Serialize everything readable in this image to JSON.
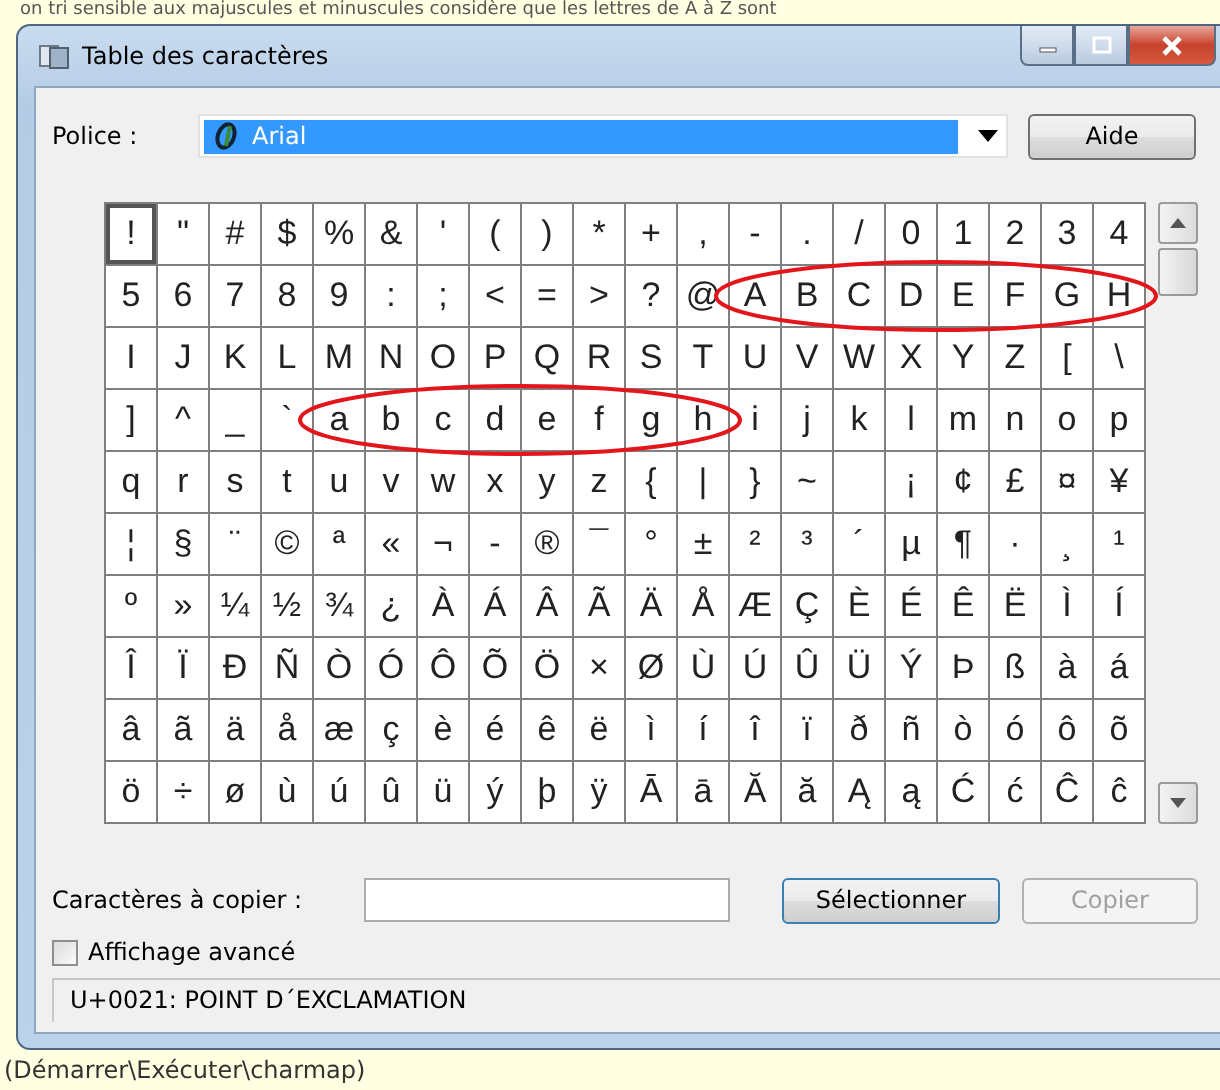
{
  "page_note": "on tri sensible aux majuscules et minuscules considère que les lettres de A à Z sont",
  "window": {
    "title": "Table des caractères"
  },
  "font_label": "Police :",
  "font_value": "Arial",
  "help_button": "Aide",
  "grid": [
    [
      {
        "char": "!",
        "selected": true,
        "circled": false
      },
      {
        "char": "\"",
        "selected": false,
        "circled": false
      },
      {
        "char": "#",
        "selected": false,
        "circled": false
      },
      {
        "char": "$",
        "selected": false,
        "circled": false
      },
      {
        "char": "%",
        "selected": false,
        "circled": false
      },
      {
        "char": "&",
        "selected": false,
        "circled": false
      },
      {
        "char": "'",
        "selected": false,
        "circled": false
      },
      {
        "char": "(",
        "selected": false,
        "circled": false
      },
      {
        "char": ")",
        "selected": false,
        "circled": false
      },
      {
        "char": "*",
        "selected": false,
        "circled": false
      },
      {
        "char": "+",
        "selected": false,
        "circled": false
      },
      {
        "char": ",",
        "selected": false,
        "circled": false
      },
      {
        "char": "-",
        "selected": false,
        "circled": false
      },
      {
        "char": ".",
        "selected": false,
        "circled": false
      },
      {
        "char": "/",
        "selected": false,
        "circled": false
      },
      {
        "char": "0",
        "selected": false,
        "circled": false
      },
      {
        "char": "1",
        "selected": false,
        "circled": false
      },
      {
        "char": "2",
        "selected": false,
        "circled": false
      },
      {
        "char": "3",
        "selected": false,
        "circled": false
      },
      {
        "char": "4",
        "selected": false,
        "circled": false
      }
    ],
    [
      {
        "char": "5",
        "selected": false,
        "circled": false
      },
      {
        "char": "6",
        "selected": false,
        "circled": false
      },
      {
        "char": "7",
        "selected": false,
        "circled": false
      },
      {
        "char": "8",
        "selected": false,
        "circled": false
      },
      {
        "char": "9",
        "selected": false,
        "circled": false
      },
      {
        "char": ":",
        "selected": false,
        "circled": false
      },
      {
        "char": ";",
        "selected": false,
        "circled": false
      },
      {
        "char": "<",
        "selected": false,
        "circled": false
      },
      {
        "char": "=",
        "selected": false,
        "circled": false
      },
      {
        "char": ">",
        "selected": false,
        "circled": false
      },
      {
        "char": "?",
        "selected": false,
        "circled": false
      },
      {
        "char": "@",
        "selected": false,
        "circled": false
      },
      {
        "char": "A",
        "selected": false,
        "circled": true
      },
      {
        "char": "B",
        "selected": false,
        "circled": true
      },
      {
        "char": "C",
        "selected": false,
        "circled": true
      },
      {
        "char": "D",
        "selected": false,
        "circled": true
      },
      {
        "char": "E",
        "selected": false,
        "circled": true
      },
      {
        "char": "F",
        "selected": false,
        "circled": true
      },
      {
        "char": "G",
        "selected": false,
        "circled": true
      },
      {
        "char": "H",
        "selected": false,
        "circled": true
      }
    ],
    [
      {
        "char": "I",
        "selected": false,
        "circled": false
      },
      {
        "char": "J",
        "selected": false,
        "circled": false
      },
      {
        "char": "K",
        "selected": false,
        "circled": false
      },
      {
        "char": "L",
        "selected": false,
        "circled": false
      },
      {
        "char": "M",
        "selected": false,
        "circled": false
      },
      {
        "char": "N",
        "selected": false,
        "circled": false
      },
      {
        "char": "O",
        "selected": false,
        "circled": false
      },
      {
        "char": "P",
        "selected": false,
        "circled": false
      },
      {
        "char": "Q",
        "selected": false,
        "circled": false
      },
      {
        "char": "R",
        "selected": false,
        "circled": false
      },
      {
        "char": "S",
        "selected": false,
        "circled": false
      },
      {
        "char": "T",
        "selected": false,
        "circled": false
      },
      {
        "char": "U",
        "selected": false,
        "circled": false
      },
      {
        "char": "V",
        "selected": false,
        "circled": false
      },
      {
        "char": "W",
        "selected": false,
        "circled": false
      },
      {
        "char": "X",
        "selected": false,
        "circled": false
      },
      {
        "char": "Y",
        "selected": false,
        "circled": false
      },
      {
        "char": "Z",
        "selected": false,
        "circled": false
      },
      {
        "char": "[",
        "selected": false,
        "circled": false
      },
      {
        "char": "\\",
        "selected": false,
        "circled": false
      }
    ],
    [
      {
        "char": "]",
        "selected": false,
        "circled": false
      },
      {
        "char": "^",
        "selected": false,
        "circled": false
      },
      {
        "char": "_",
        "selected": false,
        "circled": false
      },
      {
        "char": "`",
        "selected": false,
        "circled": false
      },
      {
        "char": "a",
        "selected": false,
        "circled": true
      },
      {
        "char": "b",
        "selected": false,
        "circled": true
      },
      {
        "char": "c",
        "selected": false,
        "circled": true
      },
      {
        "char": "d",
        "selected": false,
        "circled": true
      },
      {
        "char": "e",
        "selected": false,
        "circled": true
      },
      {
        "char": "f",
        "selected": false,
        "circled": true
      },
      {
        "char": "g",
        "selected": false,
        "circled": true
      },
      {
        "char": "h",
        "selected": false,
        "circled": true
      },
      {
        "char": "i",
        "selected": false,
        "circled": false
      },
      {
        "char": "j",
        "selected": false,
        "circled": false
      },
      {
        "char": "k",
        "selected": false,
        "circled": false
      },
      {
        "char": "l",
        "selected": false,
        "circled": false
      },
      {
        "char": "m",
        "selected": false,
        "circled": false
      },
      {
        "char": "n",
        "selected": false,
        "circled": false
      },
      {
        "char": "o",
        "selected": false,
        "circled": false
      },
      {
        "char": "p",
        "selected": false,
        "circled": false
      }
    ],
    [
      {
        "char": "q",
        "selected": false,
        "circled": false
      },
      {
        "char": "r",
        "selected": false,
        "circled": false
      },
      {
        "char": "s",
        "selected": false,
        "circled": false
      },
      {
        "char": "t",
        "selected": false,
        "circled": false
      },
      {
        "char": "u",
        "selected": false,
        "circled": false
      },
      {
        "char": "v",
        "selected": false,
        "circled": false
      },
      {
        "char": "w",
        "selected": false,
        "circled": false
      },
      {
        "char": "x",
        "selected": false,
        "circled": false
      },
      {
        "char": "y",
        "selected": false,
        "circled": false
      },
      {
        "char": "z",
        "selected": false,
        "circled": false
      },
      {
        "char": "{",
        "selected": false,
        "circled": false
      },
      {
        "char": "|",
        "selected": false,
        "circled": false
      },
      {
        "char": "}",
        "selected": false,
        "circled": false
      },
      {
        "char": "~",
        "selected": false,
        "circled": false
      },
      {
        "selected": false,
        "circled": false
      },
      {
        "char": "¡",
        "selected": false,
        "circled": false
      },
      {
        "char": "¢",
        "selected": false,
        "circled": false
      },
      {
        "char": "£",
        "selected": false,
        "circled": false
      },
      {
        "char": "¤",
        "selected": false,
        "circled": false
      },
      {
        "char": "¥",
        "selected": false,
        "circled": false
      }
    ],
    [
      {
        "char": "¦",
        "selected": false,
        "circled": false
      },
      {
        "char": "§",
        "selected": false,
        "circled": false
      },
      {
        "char": "¨",
        "selected": false,
        "circled": false
      },
      {
        "char": "©",
        "selected": false,
        "circled": false
      },
      {
        "char": "ª",
        "selected": false,
        "circled": false
      },
      {
        "char": "«",
        "selected": false,
        "circled": false
      },
      {
        "char": "¬",
        "selected": false,
        "circled": false
      },
      {
        "char": "-",
        "selected": false,
        "circled": false
      },
      {
        "char": "®",
        "selected": false,
        "circled": false
      },
      {
        "char": "¯",
        "selected": false,
        "circled": false
      },
      {
        "char": "°",
        "selected": false,
        "circled": false
      },
      {
        "char": "±",
        "selected": false,
        "circled": false
      },
      {
        "char": "²",
        "selected": false,
        "circled": false
      },
      {
        "char": "³",
        "selected": false,
        "circled": false
      },
      {
        "char": "´",
        "selected": false,
        "circled": false
      },
      {
        "char": "µ",
        "selected": false,
        "circled": false
      },
      {
        "char": "¶",
        "selected": false,
        "circled": false
      },
      {
        "char": "·",
        "selected": false,
        "circled": false
      },
      {
        "char": "¸",
        "selected": false,
        "circled": false
      },
      {
        "char": "¹",
        "selected": false,
        "circled": false
      }
    ],
    [
      {
        "char": "º",
        "selected": false,
        "circled": false
      },
      {
        "char": "»",
        "selected": false,
        "circled": false
      },
      {
        "char": "¼",
        "selected": false,
        "circled": false
      },
      {
        "char": "½",
        "selected": false,
        "circled": false
      },
      {
        "char": "¾",
        "selected": false,
        "circled": false
      },
      {
        "char": "¿",
        "selected": false,
        "circled": false
      },
      {
        "char": "À",
        "selected": false,
        "circled": false
      },
      {
        "char": "Á",
        "selected": false,
        "circled": false
      },
      {
        "char": "Â",
        "selected": false,
        "circled": false
      },
      {
        "char": "Ã",
        "selected": false,
        "circled": false
      },
      {
        "char": "Ä",
        "selected": false,
        "circled": false
      },
      {
        "char": "Å",
        "selected": false,
        "circled": false
      },
      {
        "char": "Æ",
        "selected": false,
        "circled": false
      },
      {
        "char": "Ç",
        "selected": false,
        "circled": false
      },
      {
        "char": "È",
        "selected": false,
        "circled": false
      },
      {
        "char": "É",
        "selected": false,
        "circled": false
      },
      {
        "char": "Ê",
        "selected": false,
        "circled": false
      },
      {
        "char": "Ë",
        "selected": false,
        "circled": false
      },
      {
        "char": "Ì",
        "selected": false,
        "circled": false
      },
      {
        "char": "Í",
        "selected": false,
        "circled": false
      }
    ],
    [
      {
        "char": "Î",
        "selected": false,
        "circled": false
      },
      {
        "char": "Ï",
        "selected": false,
        "circled": false
      },
      {
        "char": "Ð",
        "selected": false,
        "circled": false
      },
      {
        "char": "Ñ",
        "selected": false,
        "circled": false
      },
      {
        "char": "Ò",
        "selected": false,
        "circled": false
      },
      {
        "char": "Ó",
        "selected": false,
        "circled": false
      },
      {
        "char": "Ô",
        "selected": false,
        "circled": false
      },
      {
        "char": "Õ",
        "selected": false,
        "circled": false
      },
      {
        "char": "Ö",
        "selected": false,
        "circled": false
      },
      {
        "char": "×",
        "selected": false,
        "circled": false
      },
      {
        "char": "Ø",
        "selected": false,
        "circled": false
      },
      {
        "char": "Ù",
        "selected": false,
        "circled": false
      },
      {
        "char": "Ú",
        "selected": false,
        "circled": false
      },
      {
        "char": "Û",
        "selected": false,
        "circled": false
      },
      {
        "char": "Ü",
        "selected": false,
        "circled": false
      },
      {
        "char": "Ý",
        "selected": false,
        "circled": false
      },
      {
        "char": "Þ",
        "selected": false,
        "circled": false
      },
      {
        "char": "ß",
        "selected": false,
        "circled": false
      },
      {
        "char": "à",
        "selected": false,
        "circled": false
      },
      {
        "char": "á",
        "selected": false,
        "circled": false
      }
    ],
    [
      {
        "char": "â",
        "selected": false,
        "circled": false
      },
      {
        "char": "ã",
        "selected": false,
        "circled": false
      },
      {
        "char": "ä",
        "selected": false,
        "circled": false
      },
      {
        "char": "å",
        "selected": false,
        "circled": false
      },
      {
        "char": "æ",
        "selected": false,
        "circled": false
      },
      {
        "char": "ç",
        "selected": false,
        "circled": false
      },
      {
        "char": "è",
        "selected": false,
        "circled": false
      },
      {
        "char": "é",
        "selected": false,
        "circled": false
      },
      {
        "char": "ê",
        "selected": false,
        "circled": false
      },
      {
        "char": "ë",
        "selected": false,
        "circled": false
      },
      {
        "char": "ì",
        "selected": false,
        "circled": false
      },
      {
        "char": "í",
        "selected": false,
        "circled": false
      },
      {
        "char": "î",
        "selected": false,
        "circled": false
      },
      {
        "char": "ï",
        "selected": false,
        "circled": false
      },
      {
        "char": "ð",
        "selected": false,
        "circled": false
      },
      {
        "char": "ñ",
        "selected": false,
        "circled": false
      },
      {
        "char": "ò",
        "selected": false,
        "circled": false
      },
      {
        "char": "ó",
        "selected": false,
        "circled": false
      },
      {
        "char": "ô",
        "selected": false,
        "circled": false
      },
      {
        "char": "õ",
        "selected": false,
        "circled": false
      }
    ],
    [
      {
        "char": "ö",
        "selected": false,
        "circled": false
      },
      {
        "char": "÷",
        "selected": false,
        "circled": false
      },
      {
        "char": "ø",
        "selected": false,
        "circled": false
      },
      {
        "char": "ù",
        "selected": false,
        "circled": false
      },
      {
        "char": "ú",
        "selected": false,
        "circled": false
      },
      {
        "char": "û",
        "selected": false,
        "circled": false
      },
      {
        "char": "ü",
        "selected": false,
        "circled": false
      },
      {
        "char": "ý",
        "selected": false,
        "circled": false
      },
      {
        "char": "þ",
        "selected": false,
        "circled": false
      },
      {
        "char": "ÿ",
        "selected": false,
        "circled": false
      },
      {
        "char": "Ā",
        "selected": false,
        "circled": false
      },
      {
        "char": "ā",
        "selected": false,
        "circled": false
      },
      {
        "char": "Ă",
        "selected": false,
        "circled": false
      },
      {
        "char": "ă",
        "selected": false,
        "circled": false
      },
      {
        "char": "Ą",
        "selected": false,
        "circled": false
      },
      {
        "char": "ą",
        "selected": false,
        "circled": false
      },
      {
        "char": "Ć",
        "selected": false,
        "circled": false
      },
      {
        "char": "ć",
        "selected": false,
        "circled": false
      },
      {
        "char": "Ĉ",
        "selected": false,
        "circled": false
      },
      {
        "char": "ĉ",
        "selected": false,
        "circled": false
      }
    ]
  ],
  "copy_label": "Caractères à copier :",
  "select_button": "Sélectionner",
  "copy_button": {
    "label": "Copier",
    "disabled": true
  },
  "advanced": {
    "label": "Affichage avancé",
    "checked": false
  },
  "status": "U+0021: POINT D´EXCLAMATION",
  "caption": "(Démarrer\\Exécuter\\charmap)"
}
